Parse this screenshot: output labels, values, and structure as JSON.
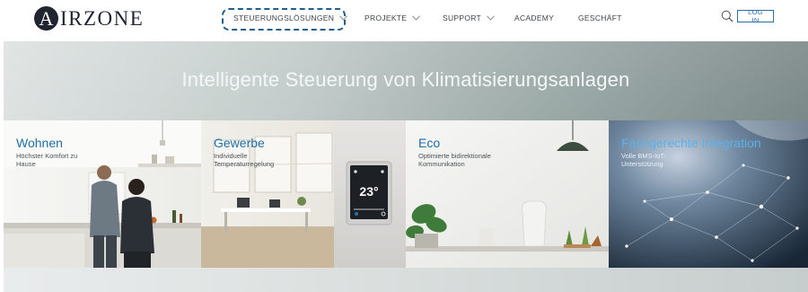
{
  "brand": {
    "logo_mark": "A",
    "logo_text": "IRZONE"
  },
  "nav": {
    "items": [
      {
        "label": "STEUERUNGSLÖSUNGEN",
        "has_dropdown": true,
        "icon": "chevron-down-icon"
      },
      {
        "label": "PROJEKTE",
        "has_dropdown": true,
        "icon": "chevron-down-icon"
      },
      {
        "label": "SUPPORT",
        "has_dropdown": true,
        "icon": "chevron-down-icon"
      },
      {
        "label": "ACADEMY",
        "has_dropdown": false
      },
      {
        "label": "GESCHÄFT",
        "has_dropdown": false
      }
    ],
    "highlighted_item": "STEUERUNGSLÖSUNGEN",
    "search_icon": "search-icon",
    "login_label": "LOG IN"
  },
  "hero": {
    "title": "Intelligente Steuerung von Klimatisierungsanlagen"
  },
  "cards": [
    {
      "title": "Wohnen",
      "subtitle": "Höchster Komfort zu\nHause"
    },
    {
      "title": "Gewerbe",
      "subtitle": "Individuelle\nTemperaturregelung"
    },
    {
      "title": "Eco",
      "subtitle": "Optimierte bidirektionale\nKommunikation"
    },
    {
      "title": "Fachgerechte Integration",
      "subtitle": "Volle BMS-IoT-\nUnterstützung"
    }
  ],
  "thermostat": {
    "temperature": "23°"
  },
  "colors": {
    "accent": "#2b6fa8",
    "highlight_dash": "#1f5f8f",
    "card_title": "#1f6ea8",
    "logo": "#1f2430"
  }
}
